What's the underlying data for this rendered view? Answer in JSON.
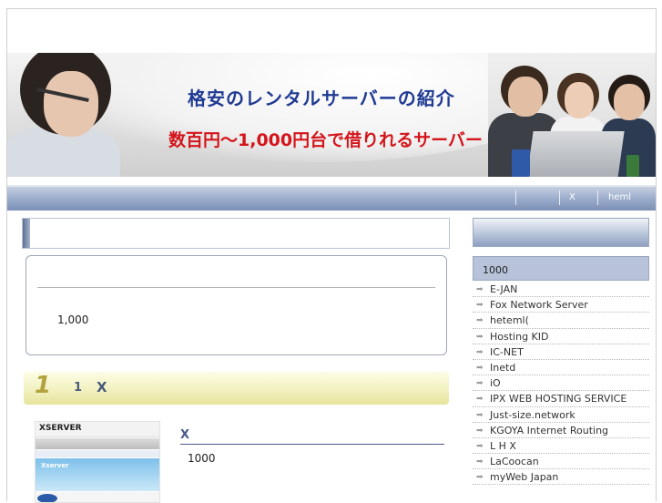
{
  "banner": {
    "title": "格安のレンタルサーバーの紹介",
    "subtitle": "数百円～1,000円台で借りれるサーバー"
  },
  "nav": {
    "items": [
      "X",
      "heml"
    ]
  },
  "main": {
    "heading": "",
    "box_value": "1,000",
    "ranking": {
      "number": "1",
      "small_number": "1",
      "label": "X"
    },
    "item": {
      "title": "X",
      "value": "1000",
      "thumbnail_logo": "XSERVER",
      "thumbnail_tagline": "Xserver"
    }
  },
  "sidebar": {
    "heading": "",
    "category": "1000",
    "links": [
      "E-JAN",
      "Fox Network Server",
      "heteml(",
      "Hosting KID",
      "IC-NET",
      "Inetd",
      "iO",
      "IPX WEB HOSTING SERVICE",
      "Just-size.network",
      "KGOYA Internet Routing",
      "L H X",
      "LaCoocan",
      "myWeb Japan"
    ]
  },
  "colors": {
    "banner_title": "#1f3a93",
    "banner_subtitle": "#d4151b",
    "navbar": "#8d9fc2",
    "rank_bar": "#f1f0bd"
  }
}
